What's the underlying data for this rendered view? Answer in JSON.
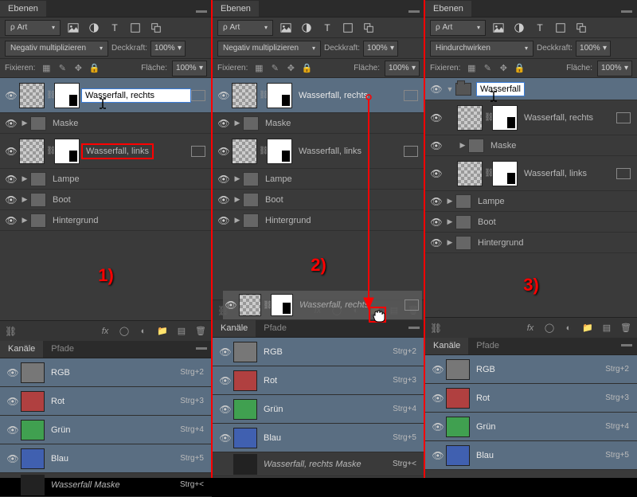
{
  "tabs": {
    "layers": "Ebenen",
    "channels": "Kanäle",
    "paths": "Pfade"
  },
  "filter": {
    "kind": "Art"
  },
  "blend": {
    "multiply": "Negativ multiplizieren",
    "through": "Hindurchwirken",
    "opacity": "Deckkraft:",
    "fill": "Fläche:",
    "lock": "Fixieren:",
    "pct100": "100%"
  },
  "layers": {
    "wrechts": "Wasserfall, rechts",
    "wlinks": "Wasserfall, links",
    "maske": "Maske",
    "lampe": "Lampe",
    "boot": "Boot",
    "hinter": "Hintergrund",
    "wgroup": "Wasserfall"
  },
  "channels": {
    "rgb": {
      "name": "RGB",
      "key": "Strg+2"
    },
    "rot": {
      "name": "Rot",
      "key": "Strg+3"
    },
    "gruen": {
      "name": "Grün",
      "key": "Strg+4"
    },
    "blau": {
      "name": "Blau",
      "key": "Strg+5"
    },
    "wmr": {
      "name": "Wasserfall Maske",
      "key": "Strg+<"
    },
    "wrm": {
      "name": "Wasserfall, rechts Maske",
      "key": "Strg+<"
    }
  },
  "steps": {
    "s1": "1)",
    "s2": "2)",
    "s3": "3)"
  }
}
